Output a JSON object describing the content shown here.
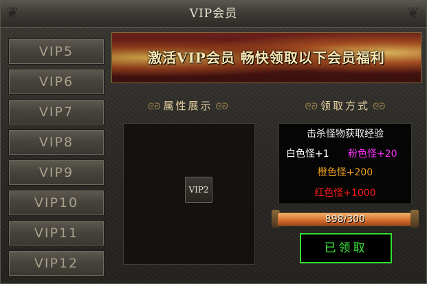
{
  "window": {
    "title": "VIP会员"
  },
  "sidebar": {
    "items": [
      {
        "label": "VIP5"
      },
      {
        "label": "VIP6"
      },
      {
        "label": "VIP7"
      },
      {
        "label": "VIP8"
      },
      {
        "label": "VIP9"
      },
      {
        "label": "VIP10"
      },
      {
        "label": "VIP11"
      },
      {
        "label": "VIP12"
      }
    ]
  },
  "banner": {
    "text": "激活VIP会员  畅快领取以下会员福利"
  },
  "attributes": {
    "heading": "属性展示",
    "vip_badge": "VIP2"
  },
  "claim": {
    "heading": "领取方式",
    "line1": "击杀怪物获取经验",
    "white_monster": "白色怪+1",
    "pink_monster": "粉色怪+20",
    "orange_monster": "橙色怪+200",
    "red_monster": "红色怪+1000",
    "progress_text": "898/300",
    "progress_fraction": 1.0,
    "button_label": "已领取"
  },
  "colors": {
    "white_monster": "#ffffff",
    "pink_monster": "#ff33ff",
    "orange_monster": "#f0a020",
    "red_monster": "#ff1a1a",
    "claimed_button": "#31e031"
  }
}
